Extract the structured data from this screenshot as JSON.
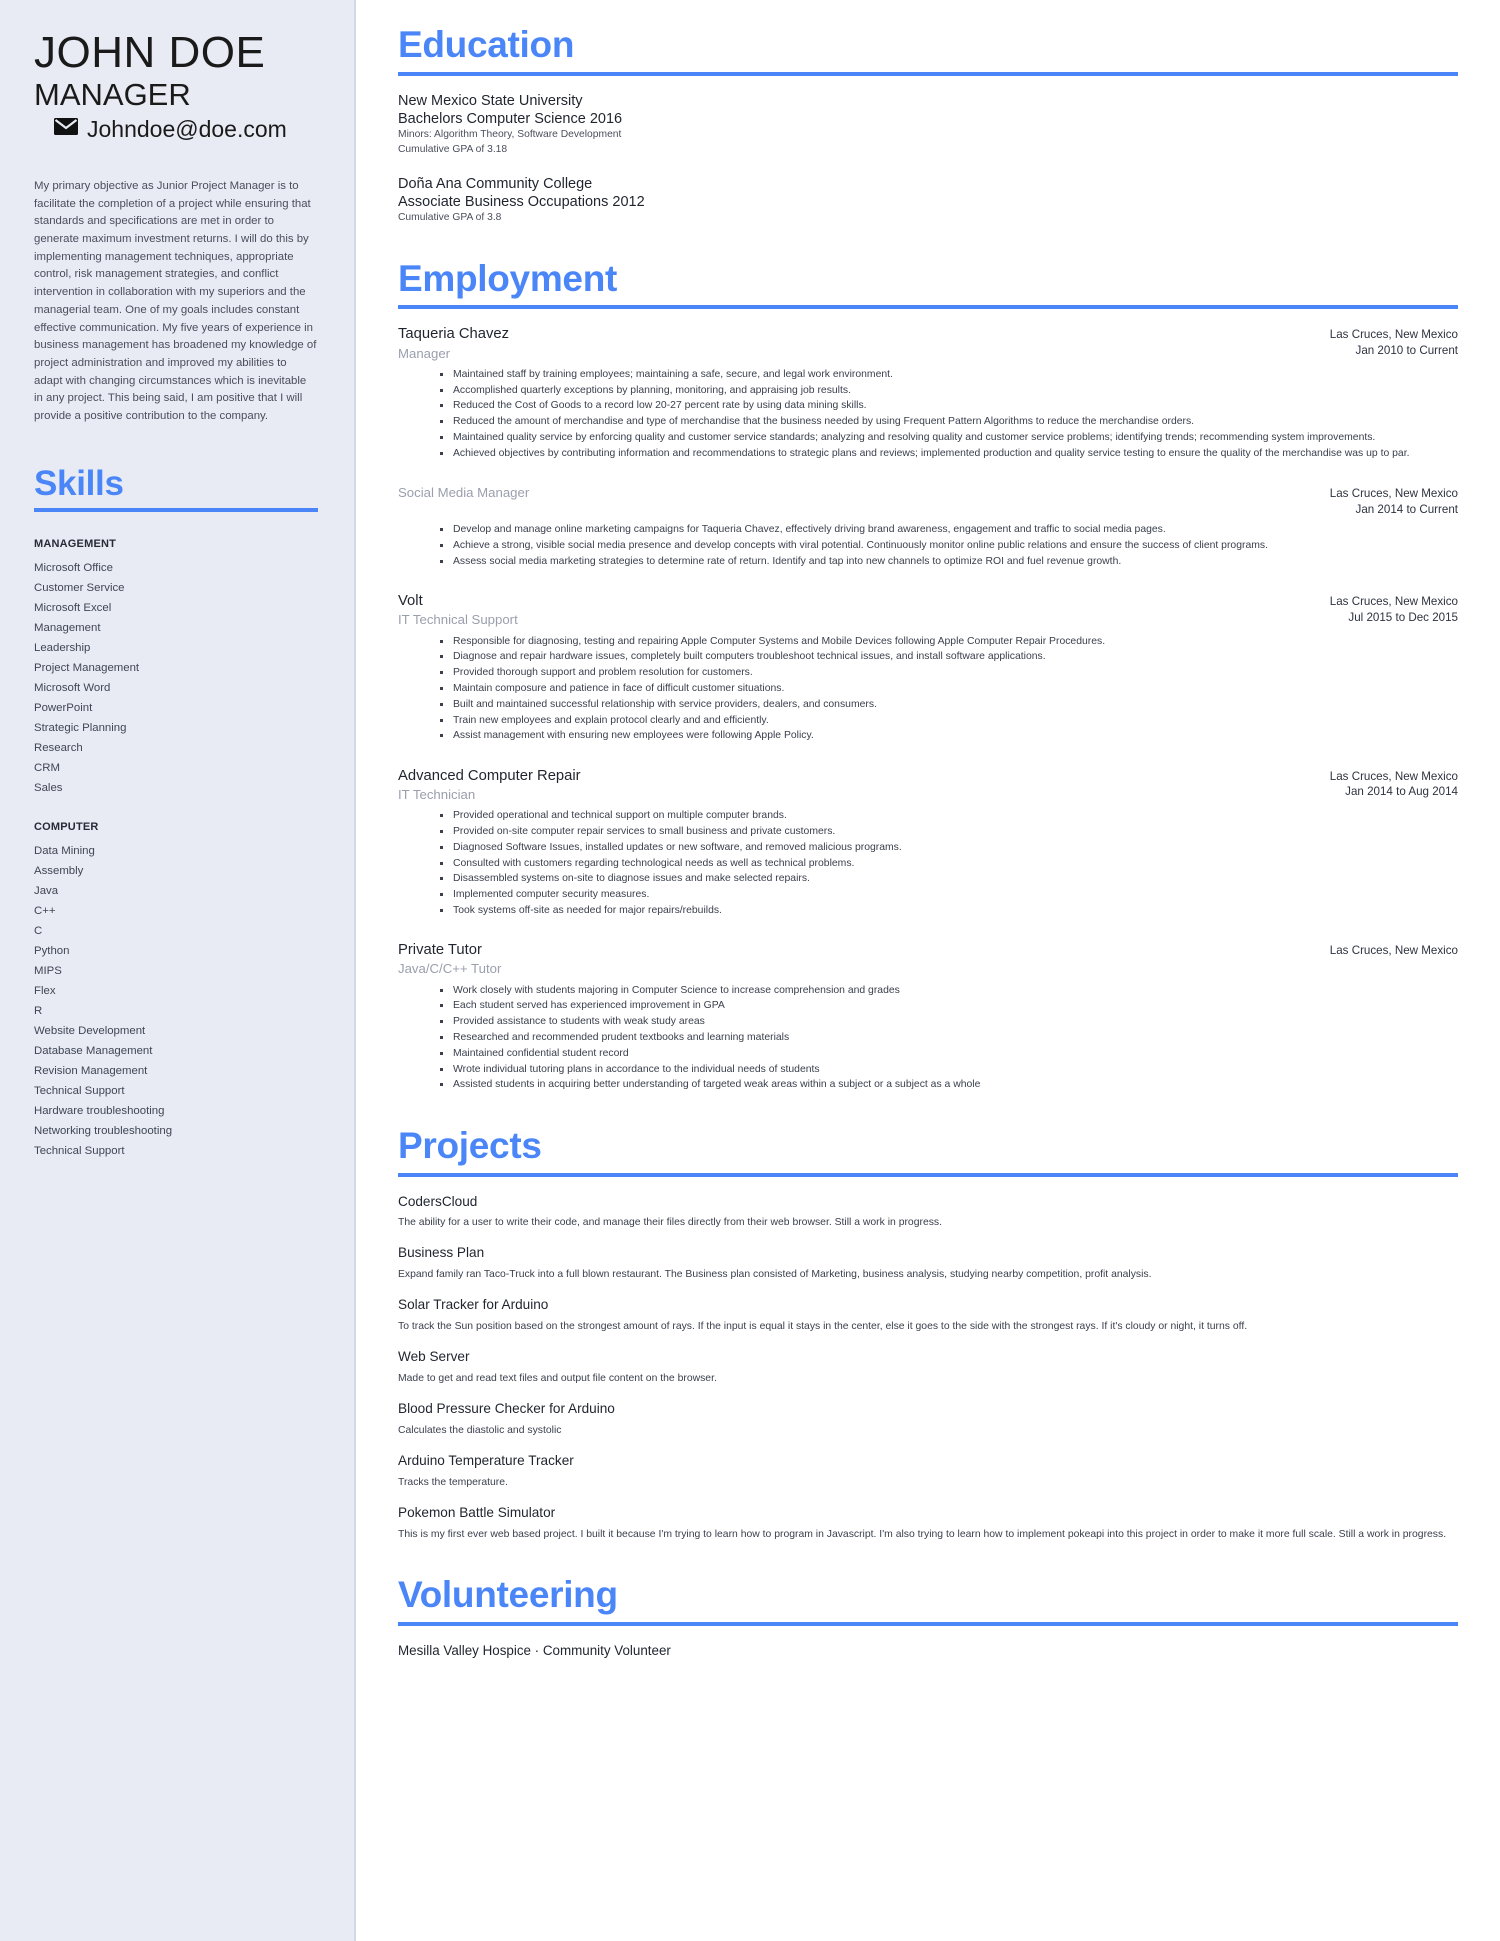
{
  "profile": {
    "name": "JOHN DOE",
    "role": "MANAGER",
    "email": "Johndoe@doe.com",
    "email_icon": "envelope-icon",
    "summary": "My primary objective as Junior Project Manager is to facilitate the completion of a project while ensuring that standards and specifications are met in order to generate maximum investment returns. I will do this by implementing management techniques, appropriate control, risk management strategies, and conflict intervention in collaboration with my superiors and the managerial team. One of my goals includes constant effective communication. My five years of experience in business management has broadened my knowledge of project administration and improved my abilities to adapt with changing circumstances which is inevitable in any project. This being said, I am positive that I will provide a positive contribution to the company."
  },
  "theme": {
    "accent": "#4a86f7",
    "sidebar_bg": "#e8ebf4",
    "text": "#1f242e",
    "muted": "#9a9fae"
  },
  "skills": {
    "heading": "Skills",
    "groups": [
      {
        "category": "MANAGEMENT",
        "items": [
          "Microsoft Office",
          "Customer Service",
          "Microsoft Excel",
          "Management",
          "Leadership",
          "Project Management",
          "Microsoft Word",
          "PowerPoint",
          "Strategic Planning",
          "Research",
          "CRM",
          "Sales"
        ]
      },
      {
        "category": "COMPUTER",
        "items": [
          "Data Mining",
          "Assembly",
          "Java",
          "C++",
          "C",
          "Python",
          "MIPS",
          "Flex",
          "R",
          "Website Development",
          "Database Management",
          "Revision Management",
          "Technical Support",
          "Hardware troubleshooting",
          "Networking troubleshooting",
          "Technical Support"
        ]
      }
    ]
  },
  "education": {
    "heading": "Education",
    "entries": [
      {
        "school": "New Mexico State University",
        "degree": "Bachelors Computer Science 2016",
        "notes": [
          "Minors: Algorithm Theory, Software Development",
          "Cumulative GPA of 3.18"
        ]
      },
      {
        "school": "Doña Ana Community College",
        "degree": "Associate Business Occupations 2012",
        "notes": [
          "Cumulative GPA of 3.8"
        ]
      }
    ]
  },
  "employment": {
    "heading": "Employment",
    "jobs": [
      {
        "company": "Taqueria Chavez",
        "title": "Manager",
        "location": "Las Cruces, New Mexico",
        "dates": "Jan 2010 to Current",
        "bullets": [
          "Maintained staff by training employees; maintaining a safe, secure, and legal work environment.",
          "Accomplished quarterly exceptions by planning, monitoring, and appraising job results.",
          "Reduced the Cost of Goods to a record low 20-27 percent rate by using data mining skills.",
          "Reduced the amount of merchandise and type of merchandise that the business needed by using Frequent Pattern Algorithms to reduce the merchandise orders.",
          "Maintained quality service by enforcing quality and customer service standards; analyzing and resolving quality and customer service problems; identifying trends; recommending system improvements.",
          "Achieved objectives by contributing information and recommendations to strategic plans and reviews; implemented production and quality service testing to ensure the quality of the merchandise was up to par."
        ]
      },
      {
        "company": "",
        "title": "Social Media Manager",
        "location": "Las Cruces, New Mexico",
        "dates": "Jan 2014 to Current",
        "bullets": [
          "Develop and manage online marketing campaigns for Taqueria Chavez, effectively driving brand awareness, engagement and traffic to social media pages.",
          "Achieve a strong, visible social media presence and develop concepts with viral potential. Continuously monitor online public relations and ensure the success of client programs.",
          "Assess social media marketing strategies to determine rate of return. Identify and tap into new channels to optimize ROI and fuel revenue growth."
        ]
      },
      {
        "company": "Volt",
        "title": "IT Technical Support",
        "location": "Las Cruces, New Mexico",
        "dates": "Jul 2015 to Dec 2015",
        "bullets": [
          "Responsible for diagnosing, testing and repairing Apple Computer Systems and Mobile Devices following Apple Computer Repair Procedures.",
          "Diagnose and repair hardware issues, completely built computers troubleshoot technical issues, and install software applications.",
          "Provided thorough support and problem resolution for customers.",
          "Maintain composure and patience in face of difficult customer situations.",
          "Built and maintained successful relationship with service providers, dealers, and consumers.",
          "Train new employees and explain protocol clearly and and efficiently.",
          "Assist management with ensuring new employees were following Apple Policy."
        ]
      },
      {
        "company": "Advanced Computer Repair",
        "title": "IT Technician",
        "location": "Las Cruces, New Mexico",
        "dates": "Jan 2014 to Aug 2014",
        "bullets": [
          "Provided operational and technical support on multiple computer brands.",
          "Provided on-site computer repair services to small business and private customers.",
          "Diagnosed Software Issues, installed updates or new software, and removed malicious programs.",
          "Consulted with customers regarding technological needs as well as technical problems.",
          "Disassembled systems on-site to diagnose issues and make selected repairs.",
          "Implemented computer security measures.",
          "Took systems off-site as needed for major repairs/rebuilds."
        ]
      },
      {
        "company": "Private Tutor",
        "title": "Java/C/C++ Tutor",
        "location": "Las Cruces, New Mexico",
        "dates": "",
        "bullets": [
          "Work closely with students majoring in Computer Science to increase comprehension and grades",
          "Each student served has experienced improvement in GPA",
          "Provided assistance to students with weak study areas",
          "Researched and recommended prudent textbooks and learning materials",
          "Maintained confidential student record",
          "Wrote individual tutoring plans in accordance to the individual needs of students",
          "Assisted students in acquiring better understanding of targeted weak areas within a subject or a subject as a whole"
        ]
      }
    ]
  },
  "projects": {
    "heading": "Projects",
    "items": [
      {
        "name": "CodersCloud",
        "description": "The ability for a user to write their code, and manage their files directly from their web browser. Still a work in progress."
      },
      {
        "name": "Business Plan",
        "description": "Expand family ran Taco-Truck into a full blown restaurant. The Business plan consisted of Marketing, business analysis, studying nearby competition, profit analysis."
      },
      {
        "name": "Solar Tracker for Arduino",
        "description": "To track the Sun position based on the strongest amount of rays. If the input is equal it stays in the center, else it goes to the side with the strongest rays. If it's cloudy or night, it turns off."
      },
      {
        "name": "Web Server",
        "description": "Made to get and read text files and output file content on the browser."
      },
      {
        "name": "Blood Pressure Checker for Arduino",
        "description": "Calculates the diastolic and systolic"
      },
      {
        "name": "Arduino Temperature Tracker",
        "description": "Tracks the temperature."
      },
      {
        "name": "Pokemon Battle Simulator",
        "description": "This is my first ever web based project. I built it because I'm trying to learn how to program in Javascript. I'm also trying to learn how to implement pokeapi into this project in order to make it more full scale. Still a work in progress."
      }
    ]
  },
  "volunteering": {
    "heading": "Volunteering",
    "items": [
      "Mesilla Valley Hospice · Community Volunteer"
    ]
  }
}
